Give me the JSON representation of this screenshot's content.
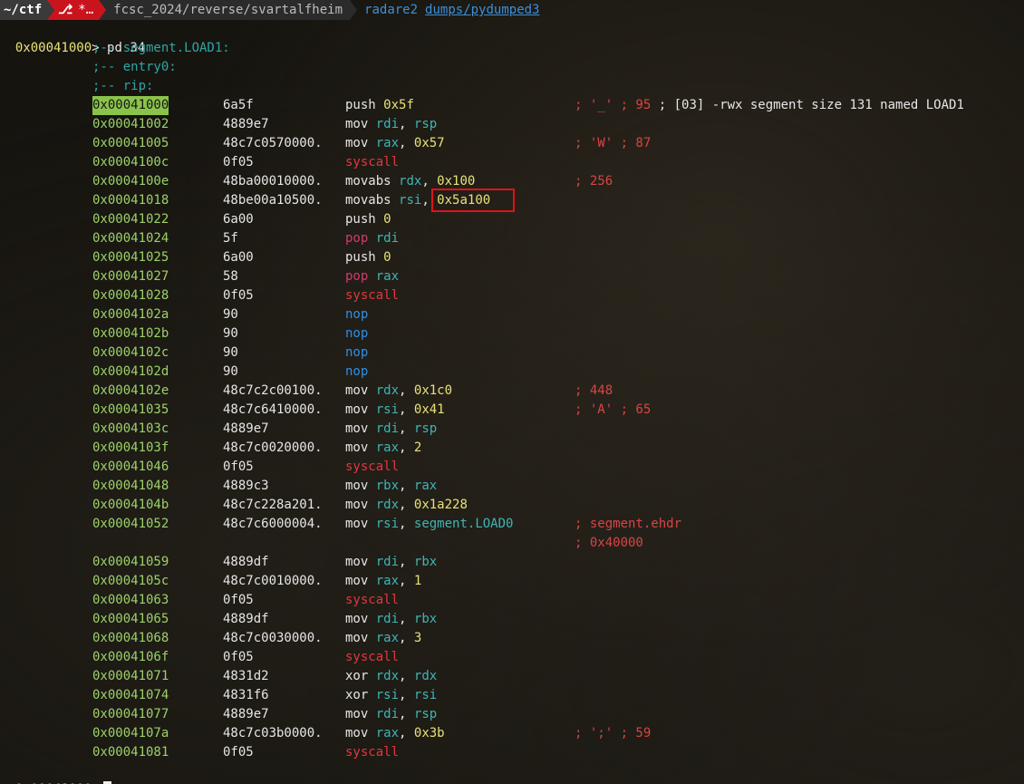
{
  "prompt": {
    "home": "~/ctf",
    "git_icon": "git-branch-icon",
    "git_status": "*…",
    "path": "fcsc_2024/reverse/svartalfheim",
    "command": "radare2",
    "argument": "dumps/pydumped3"
  },
  "r2_prompt": {
    "address": "0x00041000",
    "symbol": ">",
    "command": "pd 34"
  },
  "header_comments": [
    ";-- segment.LOAD1:",
    ";-- entry0:",
    ";-- rip:"
  ],
  "disasm": [
    {
      "addr": "0x00041000",
      "bytes": "6a5f",
      "mnemonic": "push",
      "ops": "0x5f",
      "comment": "; '_' ; 95",
      "extra": " ; [03] -rwx segment size 131 named LOAD1"
    },
    {
      "addr": "0x00041002",
      "bytes": "4889e7",
      "mnemonic": "mov",
      "ops": "rdi, rsp",
      "comment": ""
    },
    {
      "addr": "0x00041005",
      "bytes": "48c7c0570000.",
      "mnemonic": "mov",
      "ops": "rax, 0x57",
      "comment": "; 'W' ; 87"
    },
    {
      "addr": "0x0004100c",
      "bytes": "0f05",
      "mnemonic": "syscall",
      "ops": "",
      "comment": ""
    },
    {
      "addr": "0x0004100e",
      "bytes": "48ba00010000.",
      "mnemonic": "movabs",
      "ops": "rdx, 0x100",
      "comment": "; 256"
    },
    {
      "addr": "0x00041018",
      "bytes": "48be00a10500.",
      "mnemonic": "movabs",
      "ops": "rsi, 0x5a100",
      "comment": ""
    },
    {
      "addr": "0x00041022",
      "bytes": "6a00",
      "mnemonic": "push",
      "ops": "0",
      "comment": ""
    },
    {
      "addr": "0x00041024",
      "bytes": "5f",
      "mnemonic": "pop",
      "ops": "rdi",
      "comment": ""
    },
    {
      "addr": "0x00041025",
      "bytes": "6a00",
      "mnemonic": "push",
      "ops": "0",
      "comment": ""
    },
    {
      "addr": "0x00041027",
      "bytes": "58",
      "mnemonic": "pop",
      "ops": "rax",
      "comment": ""
    },
    {
      "addr": "0x00041028",
      "bytes": "0f05",
      "mnemonic": "syscall",
      "ops": "",
      "comment": ""
    },
    {
      "addr": "0x0004102a",
      "bytes": "90",
      "mnemonic": "nop",
      "ops": "",
      "comment": ""
    },
    {
      "addr": "0x0004102b",
      "bytes": "90",
      "mnemonic": "nop",
      "ops": "",
      "comment": ""
    },
    {
      "addr": "0x0004102c",
      "bytes": "90",
      "mnemonic": "nop",
      "ops": "",
      "comment": ""
    },
    {
      "addr": "0x0004102d",
      "bytes": "90",
      "mnemonic": "nop",
      "ops": "",
      "comment": ""
    },
    {
      "addr": "0x0004102e",
      "bytes": "48c7c2c00100.",
      "mnemonic": "mov",
      "ops": "rdx, 0x1c0",
      "comment": "; 448"
    },
    {
      "addr": "0x00041035",
      "bytes": "48c7c6410000.",
      "mnemonic": "mov",
      "ops": "rsi, 0x41",
      "comment": "; 'A' ; 65"
    },
    {
      "addr": "0x0004103c",
      "bytes": "4889e7",
      "mnemonic": "mov",
      "ops": "rdi, rsp",
      "comment": ""
    },
    {
      "addr": "0x0004103f",
      "bytes": "48c7c0020000.",
      "mnemonic": "mov",
      "ops": "rax, 2",
      "comment": ""
    },
    {
      "addr": "0x00041046",
      "bytes": "0f05",
      "mnemonic": "syscall",
      "ops": "",
      "comment": ""
    },
    {
      "addr": "0x00041048",
      "bytes": "4889c3",
      "mnemonic": "mov",
      "ops": "rbx, rax",
      "comment": ""
    },
    {
      "addr": "0x0004104b",
      "bytes": "48c7c228a201.",
      "mnemonic": "mov",
      "ops": "rdx, 0x1a228",
      "comment": ""
    },
    {
      "addr": "0x00041052",
      "bytes": "48c7c6000004.",
      "mnemonic": "mov",
      "ops": "rsi, segment.LOAD0",
      "comment": "; segment.ehdr",
      "comment2": "; 0x40000"
    },
    {
      "addr": "0x00041059",
      "bytes": "4889df",
      "mnemonic": "mov",
      "ops": "rdi, rbx",
      "comment": ""
    },
    {
      "addr": "0x0004105c",
      "bytes": "48c7c0010000.",
      "mnemonic": "mov",
      "ops": "rax, 1",
      "comment": ""
    },
    {
      "addr": "0x00041063",
      "bytes": "0f05",
      "mnemonic": "syscall",
      "ops": "",
      "comment": ""
    },
    {
      "addr": "0x00041065",
      "bytes": "4889df",
      "mnemonic": "mov",
      "ops": "rdi, rbx",
      "comment": ""
    },
    {
      "addr": "0x00041068",
      "bytes": "48c7c0030000.",
      "mnemonic": "mov",
      "ops": "rax, 3",
      "comment": ""
    },
    {
      "addr": "0x0004106f",
      "bytes": "0f05",
      "mnemonic": "syscall",
      "ops": "",
      "comment": ""
    },
    {
      "addr": "0x00041071",
      "bytes": "4831d2",
      "mnemonic": "xor",
      "ops": "rdx, rdx",
      "comment": ""
    },
    {
      "addr": "0x00041074",
      "bytes": "4831f6",
      "mnemonic": "xor",
      "ops": "rsi, rsi",
      "comment": ""
    },
    {
      "addr": "0x00041077",
      "bytes": "4889e7",
      "mnemonic": "mov",
      "ops": "rdi, rsp",
      "comment": ""
    },
    {
      "addr": "0x0004107a",
      "bytes": "48c7c03b0000.",
      "mnemonic": "mov",
      "ops": "rax, 0x3b",
      "comment": "; ';' ; 59"
    },
    {
      "addr": "0x00041081",
      "bytes": "0f05",
      "mnemonic": "syscall",
      "ops": "",
      "comment": ""
    }
  ],
  "highlight": {
    "operand": "0x5a100",
    "box_color": "#e0121a"
  },
  "colors": {
    "address": "#9cd16a",
    "register": "#3eb5b5",
    "number": "#e8e27a",
    "comment": "#d84545",
    "syscall": "#e0383f",
    "pop": "#d43b6a",
    "nop": "#2f8fe6"
  }
}
